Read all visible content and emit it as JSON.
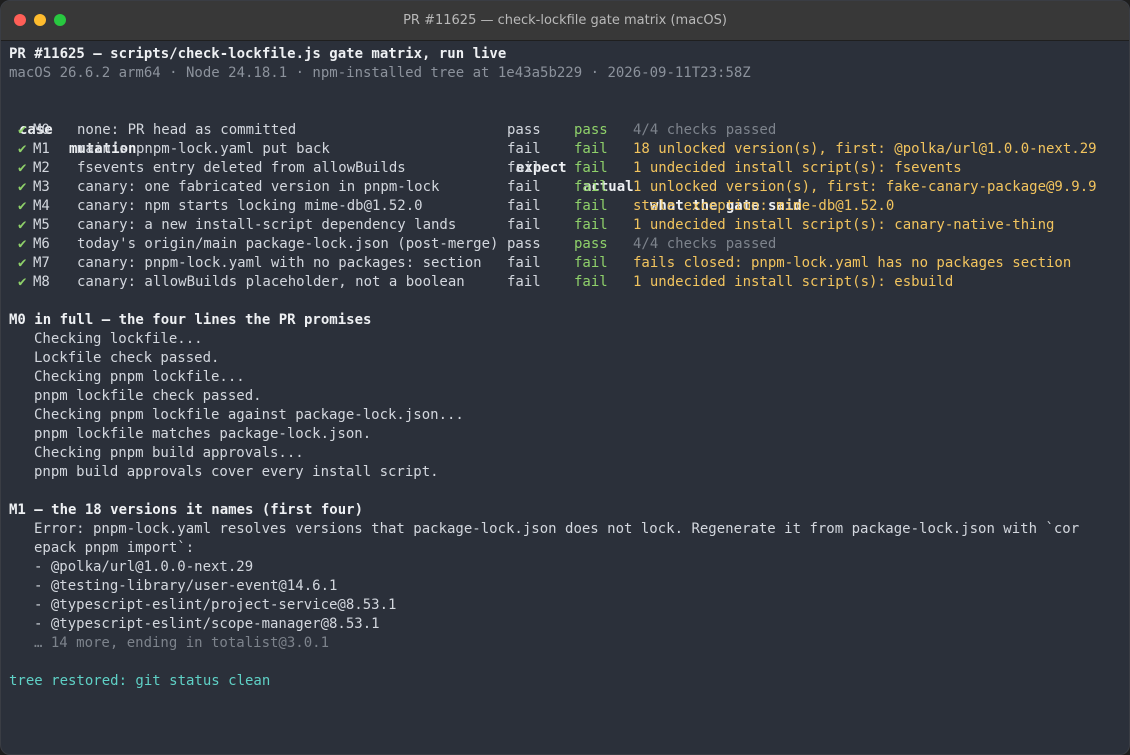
{
  "window": {
    "title": "PR #11625 — check-lockfile gate matrix (macOS)"
  },
  "header": {
    "line1": "PR #11625 — scripts/check-lockfile.js gate matrix, run live",
    "line2": "macOS 26.6.2 arm64 · Node 24.18.1 · npm-installed tree at 1e43a5b229 · 2026-09-11T23:58Z"
  },
  "table": {
    "columns": {
      "case": "case",
      "mutation": "mutation",
      "expect": "expect",
      "actual": "actual",
      "said": "what the gate said"
    },
    "check_glyph": "✔",
    "rows": [
      {
        "case": "M0",
        "mutation": "none: PR head as committed",
        "expect": "pass",
        "actual": "pass",
        "said": "4/4 checks passed",
        "tone": "gray"
      },
      {
        "case": "M1",
        "mutation": "main's pnpm-lock.yaml put back",
        "expect": "fail",
        "actual": "fail",
        "said": "18 unlocked version(s), first: @polka/url@1.0.0-next.29",
        "tone": "amber"
      },
      {
        "case": "M2",
        "mutation": "fsevents entry deleted from allowBuilds",
        "expect": "fail",
        "actual": "fail",
        "said": "1 undecided install script(s): fsevents",
        "tone": "amber"
      },
      {
        "case": "M3",
        "mutation": "canary: one fabricated version in pnpm-lock",
        "expect": "fail",
        "actual": "fail",
        "said": "1 unlocked version(s), first: fake-canary-package@9.9.9",
        "tone": "amber"
      },
      {
        "case": "M4",
        "mutation": "canary: npm starts locking mime-db@1.52.0",
        "expect": "fail",
        "actual": "fail",
        "said": "stale exception: mime-db@1.52.0",
        "tone": "amber"
      },
      {
        "case": "M5",
        "mutation": "canary: a new install-script dependency lands",
        "expect": "fail",
        "actual": "fail",
        "said": "1 undecided install script(s): canary-native-thing",
        "tone": "amber"
      },
      {
        "case": "M6",
        "mutation": "today's origin/main package-lock.json (post-merge)",
        "expect": "pass",
        "actual": "pass",
        "said": "4/4 checks passed",
        "tone": "gray"
      },
      {
        "case": "M7",
        "mutation": "canary: pnpm-lock.yaml with no packages: section",
        "expect": "fail",
        "actual": "fail",
        "said": "fails closed: pnpm-lock.yaml has no packages section",
        "tone": "amber"
      },
      {
        "case": "M8",
        "mutation": "canary: allowBuilds placeholder, not a boolean",
        "expect": "fail",
        "actual": "fail",
        "said": "1 undecided install script(s): esbuild",
        "tone": "amber"
      }
    ]
  },
  "m0": {
    "heading": "M0 in full — the four lines the PR promises",
    "lines": [
      "Checking lockfile...",
      "Lockfile check passed.",
      "Checking pnpm lockfile...",
      "pnpm lockfile check passed.",
      "Checking pnpm lockfile against package-lock.json...",
      "pnpm lockfile matches package-lock.json.",
      "Checking pnpm build approvals...",
      "pnpm build approvals cover every install script."
    ]
  },
  "m1": {
    "heading": "M1 — the 18 versions it names (first four)",
    "error_line1": "Error: pnpm-lock.yaml resolves versions that package-lock.json does not lock. Regenerate it from package-lock.json with `cor",
    "error_line2": "epack pnpm import`:",
    "items": [
      "- @polka/url@1.0.0-next.29",
      "- @testing-library/user-event@14.6.1",
      "- @typescript-eslint/project-service@8.53.1",
      "- @typescript-eslint/scope-manager@8.53.1"
    ],
    "more": "… 14 more, ending in totalist@3.0.1"
  },
  "footer": {
    "status": "tree restored: git status clean"
  },
  "colors": {
    "background": "#2b303a",
    "green": "#8fd16a",
    "amber": "#f2c45e",
    "teal": "#5fd1c6",
    "dim": "#8c929c"
  }
}
